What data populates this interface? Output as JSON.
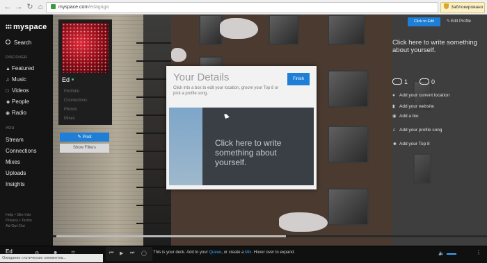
{
  "browser": {
    "url_domain": "myspace.com",
    "url_path": "/edagaga",
    "blocked_label": "Заблокировано"
  },
  "nav": {
    "logo": "myspace",
    "search": "Search",
    "discover_label": "DISCOVER",
    "discover_items": [
      "Featured",
      "Music",
      "Videos",
      "People",
      "Radio"
    ],
    "you_label": "YOU",
    "you_items": [
      "Stream",
      "Connections",
      "Mixes",
      "Uploads",
      "Insights"
    ],
    "footer_line1": "Help • Site Info",
    "footer_line2": "Privacy • Terms",
    "footer_line3": "Ad Opt-Out"
  },
  "profile": {
    "name": "Ed",
    "links": [
      "Portfolio",
      "Connections",
      "Photos",
      "Mixes"
    ],
    "post_label": "Post",
    "filters_label": "Show Filters"
  },
  "modal": {
    "title": "Your Details",
    "description": "Click into a box to edit your location, groom your Top 8 or pick a profile song.",
    "finish_label": "Finish",
    "write_prompt": "Click here to write something about yourself."
  },
  "right_panel": {
    "click_to_edit": "Click to Edit",
    "edit_profile": "Edit Profile",
    "about_prompt": "Click here to write something about yourself.",
    "count_a": "1",
    "count_b": "0",
    "links": [
      "Add your current location",
      "Add your website",
      "Add a bio",
      "Add your profile song",
      "Add your Top 8"
    ]
  },
  "player": {
    "user": "Ed",
    "deck_pre": "This is your deck. Add to your ",
    "deck_queue": "Queue",
    "deck_mid": ", or create a ",
    "deck_mix": "Mix",
    "deck_post": ". Hover over to expand."
  },
  "status_bar": "Ожидание статических элементов..."
}
